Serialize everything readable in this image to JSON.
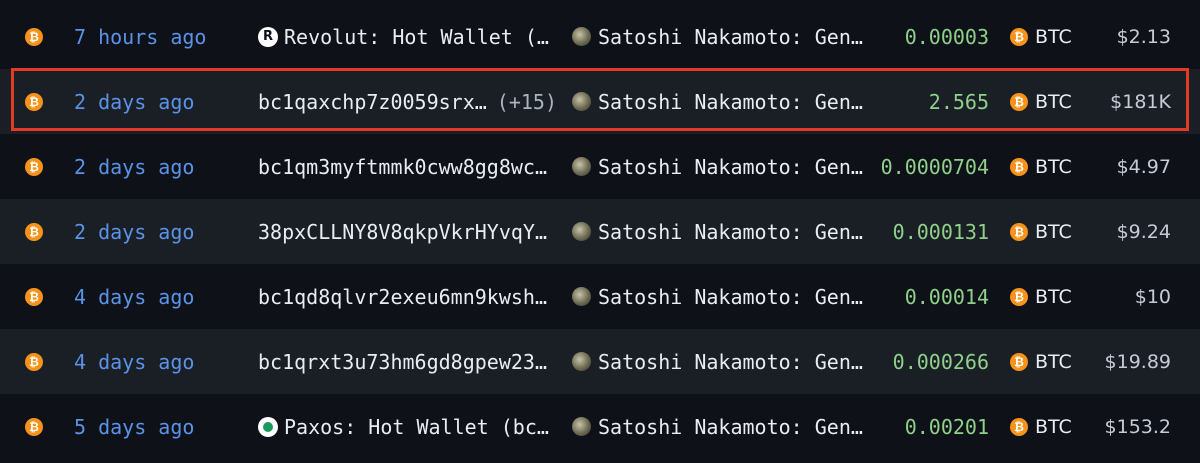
{
  "colors": {
    "background": "#0e1117",
    "row_alt": "#1a1e25",
    "time_link": "#5a93e8",
    "amount_green": "#8fd18a",
    "btc_orange": "#f7931a",
    "highlight_red": "#e23a24"
  },
  "coin_glyph": "₿",
  "rows": [
    {
      "time": "7 hours ago",
      "from_icon": "revolut-icon",
      "from": "Revolut: Hot Wallet (…",
      "from_extra": "",
      "to": "Satoshi Nakamoto: Gen…",
      "amount": "0.00003",
      "asset": "BTC",
      "usd": "$2.13"
    },
    {
      "time": "2 days ago",
      "from_icon": "",
      "from": "bc1qaxchp7z0059srx…",
      "from_extra": "(+15)",
      "to": "Satoshi Nakamoto: Gen…",
      "amount": "2.565",
      "asset": "BTC",
      "usd": "$181K",
      "highlighted": true
    },
    {
      "time": "2 days ago",
      "from_icon": "",
      "from": "bc1qm3myftmmk0cww8gg8wc…",
      "from_extra": "",
      "to": "Satoshi Nakamoto: Gen…",
      "amount": "0.0000704",
      "asset": "BTC",
      "usd": "$4.97"
    },
    {
      "time": "2 days ago",
      "from_icon": "",
      "from": "38pxCLLNY8V8qkpVkrHYvqY…",
      "from_extra": "",
      "to": "Satoshi Nakamoto: Gen…",
      "amount": "0.000131",
      "asset": "BTC",
      "usd": "$9.24"
    },
    {
      "time": "4 days ago",
      "from_icon": "",
      "from": "bc1qd8qlvr2exeu6mn9kwsh…",
      "from_extra": "",
      "to": "Satoshi Nakamoto: Gen…",
      "amount": "0.00014",
      "asset": "BTC",
      "usd": "$10"
    },
    {
      "time": "4 days ago",
      "from_icon": "",
      "from": "bc1qrxt3u73hm6gd8gpew23…",
      "from_extra": "",
      "to": "Satoshi Nakamoto: Gen…",
      "amount": "0.000266",
      "asset": "BTC",
      "usd": "$19.89"
    },
    {
      "time": "5 days ago",
      "from_icon": "paxos-icon",
      "from": "Paxos: Hot Wallet (bc…",
      "from_extra": "",
      "to": "Satoshi Nakamoto: Gen…",
      "amount": "0.00201",
      "asset": "BTC",
      "usd": "$153.2"
    }
  ]
}
